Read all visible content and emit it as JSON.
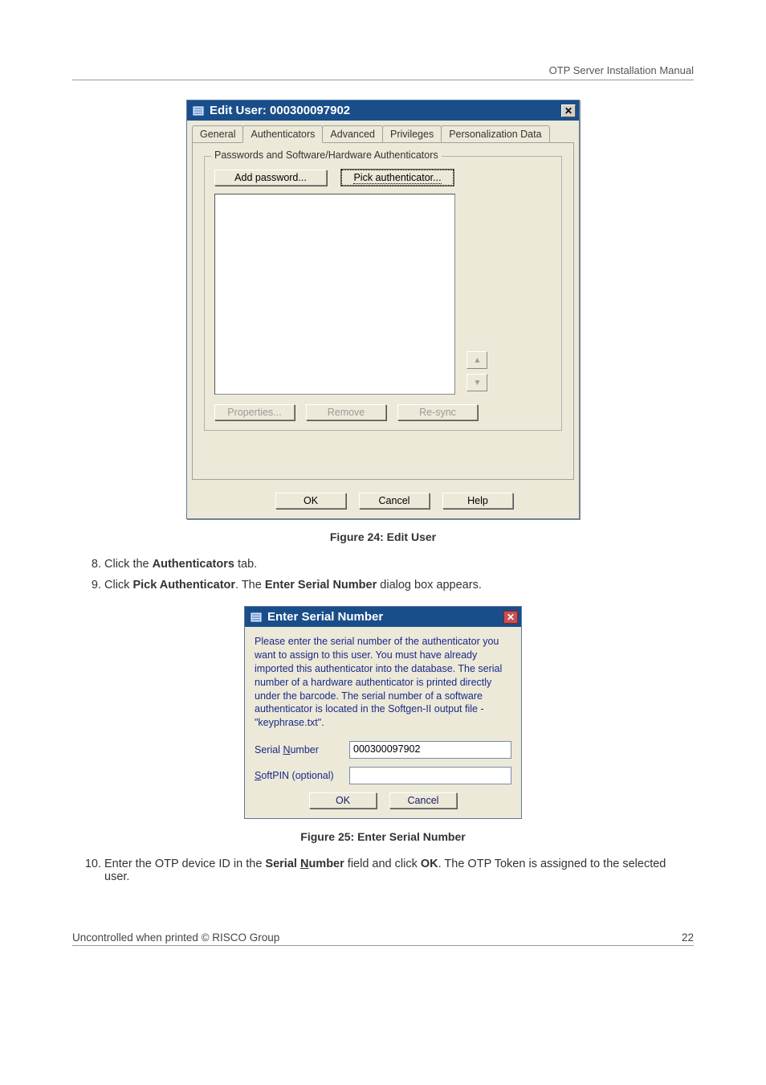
{
  "header": {
    "title": "OTP Server Installation Manual"
  },
  "dialog1": {
    "title": "Edit User: 000300097902",
    "tabs": {
      "general": "General",
      "authenticators": "Authenticators",
      "advanced": "Advanced",
      "privileges": "Privileges",
      "personalization": "Personalization Data"
    },
    "group_label": "Passwords and Software/Hardware Authenticators",
    "buttons": {
      "add_password": "Add password...",
      "pick_authenticator": "Pick authenticator...",
      "properties": "Properties...",
      "remove": "Remove",
      "resync": "Re-sync",
      "ok": "OK",
      "cancel": "Cancel",
      "help": "Help"
    }
  },
  "caption1": "Figure 24: Edit User",
  "steps": {
    "s8_a": "Click the ",
    "s8_b": "Authenticators",
    "s8_c": " tab.",
    "s9_a": "Click ",
    "s9_b": "Pick Authenticator",
    "s9_c": ". The ",
    "s9_d": "Enter Serial Number",
    "s9_e": " dialog box appears.",
    "s10_a": "Enter the OTP device ID in the ",
    "s10_b": "Serial ",
    "s10_b2": "N",
    "s10_b3": "umber",
    "s10_c": " field and click ",
    "s10_d": "OK",
    "s10_e": ". The OTP Token is assigned to the selected user."
  },
  "dialog2": {
    "title": "Enter Serial Number",
    "para": "Please enter the serial number of the authenticator you want to assign to this user.  You must have already imported this authenticator into the database.  The serial number of a hardware authenticator is printed directly under the barcode.  The serial number of a software authenticator is located in the Softgen-II output file - \"keyphrase.txt\".",
    "labels": {
      "serial_a": "Serial ",
      "serial_u": "N",
      "serial_b": "umber",
      "softpin_u": "S",
      "softpin_b": "oftPIN (optional)"
    },
    "values": {
      "serial": "000300097902",
      "softpin": ""
    },
    "buttons": {
      "ok": "OK",
      "cancel": "Cancel"
    }
  },
  "caption2": "Figure 25: Enter Serial Number",
  "footer": {
    "left": "Uncontrolled when printed © RISCO Group",
    "right": "22"
  }
}
